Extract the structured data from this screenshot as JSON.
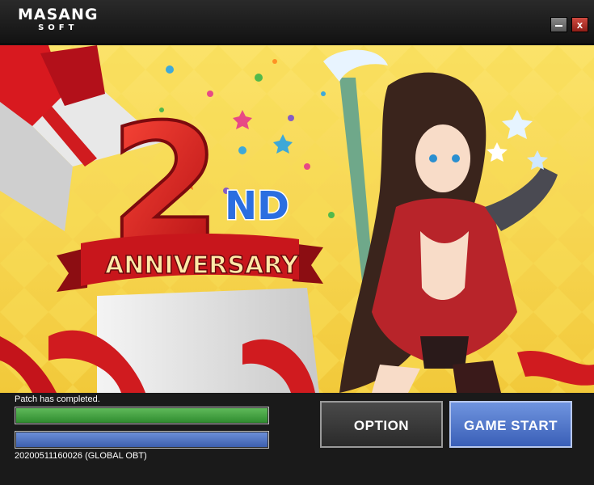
{
  "titlebar": {
    "logo_main": "MASANG",
    "logo_sub": "SOFT",
    "minimize_icon": "minimize-icon",
    "close_label": "x",
    "close_icon": "close-icon"
  },
  "banner": {
    "event_number": "2",
    "event_suffix": "ND",
    "event_title": "ANNIVERSARY"
  },
  "launcher": {
    "status_text": "Patch has completed.",
    "progress_file": 1.0,
    "progress_total": 1.0,
    "version_text": "20200511160026 (GLOBAL  OBT)",
    "option_label": "OPTION",
    "start_label": "GAME START"
  },
  "colors": {
    "progress_green": "#3fa23c",
    "progress_blue": "#4e72c4",
    "start_button": "#4e72c4",
    "banner_yellow": "#f7d84a",
    "ribbon_red": "#c8161c"
  }
}
